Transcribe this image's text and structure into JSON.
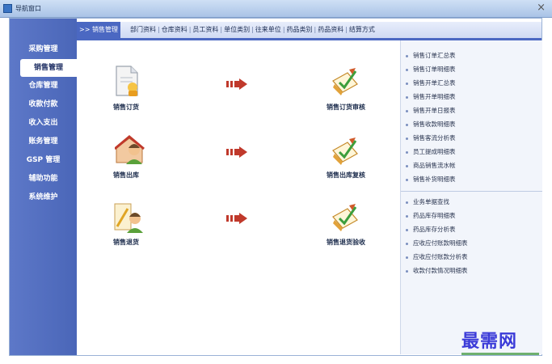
{
  "window": {
    "title": "导航窗口",
    "close_glyph": "×"
  },
  "sidebar": {
    "items": [
      {
        "label": "采购管理",
        "active": false
      },
      {
        "label": "销售管理",
        "active": true
      },
      {
        "label": "仓库管理",
        "active": false
      },
      {
        "label": "收款付款",
        "active": false
      },
      {
        "label": "收入支出",
        "active": false
      },
      {
        "label": "账务管理",
        "active": false
      },
      {
        "label": "GSP 管理",
        "active": false
      },
      {
        "label": "辅助功能",
        "active": false
      },
      {
        "label": "系统维护",
        "active": false
      }
    ]
  },
  "tabbar": {
    "active": ">> 销售管理",
    "links": [
      "部门资料",
      "仓库资料",
      "员工资料",
      "单位类别",
      "往来单位",
      "药品类别",
      "药品资料",
      "结算方式"
    ]
  },
  "flow": {
    "rows": [
      {
        "left": "销售订货",
        "right": "销售订货审核"
      },
      {
        "left": "销售出库",
        "right": "销售出库复核"
      },
      {
        "left": "销售退货",
        "right": "销售退货验收"
      }
    ]
  },
  "reports": {
    "group1": [
      "销售订单汇总表",
      "销售订单明细表",
      "销售开单汇总表",
      "销售开单明细表",
      "销售开单日报表",
      "销售收款明细表",
      "销售客流分析表",
      "员工提成明细表",
      "商品销售流水帐",
      "销售补货明细表"
    ],
    "group2": [
      "业务单据查找",
      "药品库存明细表",
      "药品库存分析表",
      "应收应付账款明细表",
      "应收应付账款分析表",
      "收款付款情况明细表"
    ]
  },
  "watermark": "最需网",
  "colors": {
    "sidebar": "#4a66b8",
    "accent": "#4b68c2",
    "arrow": "#c0392b"
  }
}
